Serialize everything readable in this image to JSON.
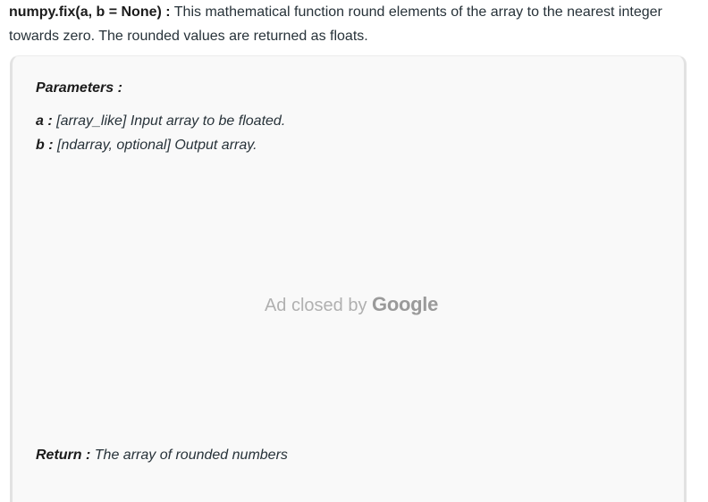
{
  "intro": {
    "signature": "numpy.fix(a, b = None) :",
    "description": " This mathematical function round elements of the array to the nearest integer towards zero. The rounded values are returned as floats."
  },
  "parameters": {
    "heading": "Parameters :",
    "items": [
      {
        "name": "a :",
        "description": " [array_like] Input array to be floated."
      },
      {
        "name": "b :",
        "description": " [ndarray, optional] Output array."
      }
    ]
  },
  "ad": {
    "text": "Ad closed by",
    "brand": "Google"
  },
  "return": {
    "label": "Return :",
    "description": " The array of rounded numbers"
  }
}
